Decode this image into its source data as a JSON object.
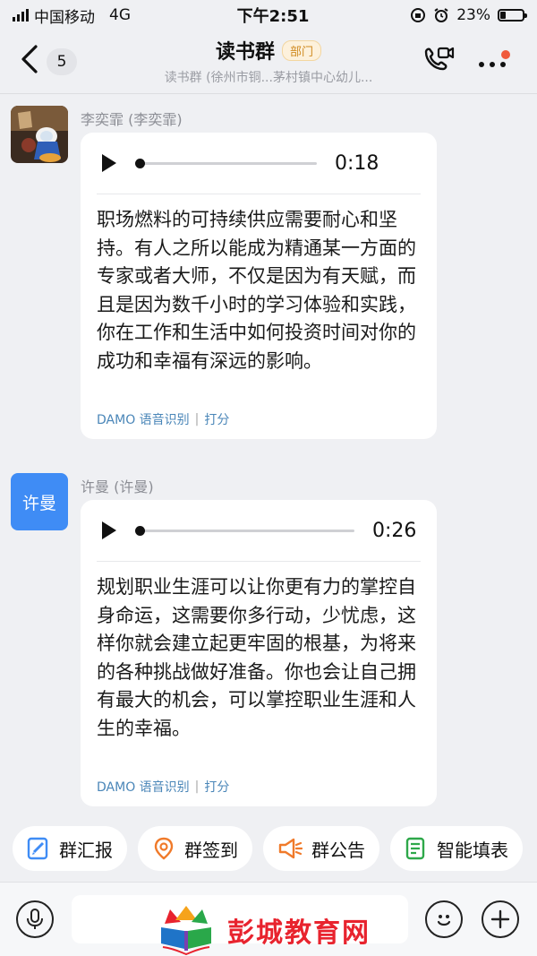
{
  "status_bar": {
    "carrier": "中国移动",
    "network": "4G",
    "time": "下午2:51",
    "battery": "23%"
  },
  "header": {
    "back_count": "5",
    "title": "读书群",
    "tag": "部门",
    "subtitle": "读书群 (徐州市铜...茅村镇中心幼儿..."
  },
  "messages": [
    {
      "sender": "李奕霏 (李奕霏)",
      "avatar_type": "photo",
      "duration": "0:18",
      "transcript": "职场燃料的可持续供应需要耐心和坚持。有人之所以能成为精通某一方面的专家或者大师，不仅是因为有天赋，而且是因为数千小时的学习体验和实践，你在工作和生活中如何投资时间对你的成功和幸福有深远的影响。",
      "source": "DAMO 语音识别",
      "rate": "打分"
    },
    {
      "sender": "许曼 (许曼)",
      "avatar_type": "text",
      "avatar_text": "许曼",
      "duration": "0:26",
      "transcript": "规划职业生涯可以让你更有力的掌控自身命运，这需要你多行动，少忧虑，这样你就会建立起更牢固的根基，为将来的各种挑战做好准备。你也会让自己拥有最大的机会，可以掌控职业生涯和人生的幸福。",
      "source": "DAMO 语音识别",
      "rate": "打分"
    }
  ],
  "quick_actions": [
    {
      "label": "群汇报",
      "icon": "report-icon"
    },
    {
      "label": "群签到",
      "icon": "location-checkin-icon"
    },
    {
      "label": "群公告",
      "icon": "megaphone-icon"
    },
    {
      "label": "智能填表",
      "icon": "form-icon"
    }
  ],
  "watermark": {
    "text": "彭城教育网"
  },
  "colors": {
    "accent_blue": "#3f8cf5",
    "tag_orange": "#d08a1f",
    "link_blue": "#4a86b8",
    "notify_red": "#f05a3c",
    "watermark_red": "#e8232e"
  }
}
